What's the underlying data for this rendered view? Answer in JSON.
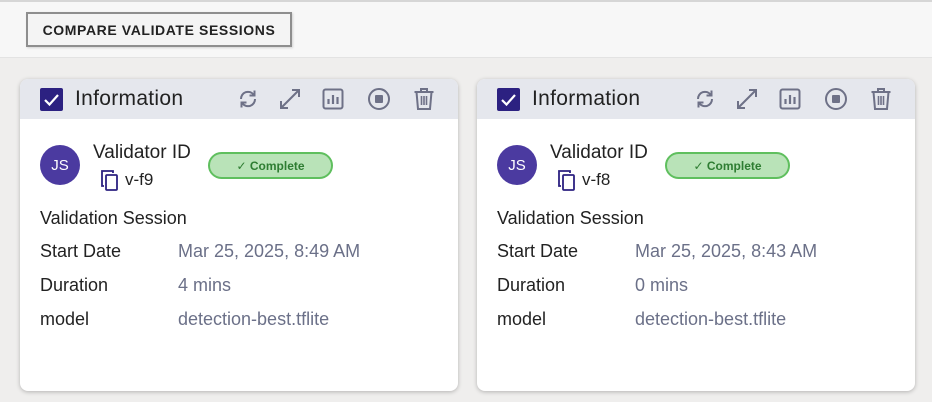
{
  "toolbar": {
    "compare_label": "COMPARE VALIDATE SESSIONS"
  },
  "colors": {
    "accent": "#2c2181",
    "avatar": "#4b3aa0",
    "badge_bg": "#b9e3b8",
    "badge_border": "#5fbf5e",
    "badge_text": "#2e7d32",
    "value_text": "#6b7088",
    "header_bg": "#e5e7ed"
  },
  "cards": [
    {
      "checked": true,
      "header_title": "Information",
      "tools": [
        "refresh-icon",
        "expand-icon",
        "chart-icon",
        "stop-icon",
        "trash-icon"
      ],
      "avatar_initials": "JS",
      "validator_label": "Validator ID",
      "validator_id": "v-f9",
      "status": "✓ Complete",
      "section_title": "Validation Session",
      "fields": [
        {
          "label": "Start Date",
          "value": "Mar 25, 2025, 8:49 AM"
        },
        {
          "label": "Duration",
          "value": "4 mins"
        },
        {
          "label": "model",
          "value": "detection-best.tflite"
        }
      ]
    },
    {
      "checked": true,
      "header_title": "Information",
      "tools": [
        "refresh-icon",
        "expand-icon",
        "chart-icon",
        "stop-icon",
        "trash-icon"
      ],
      "avatar_initials": "JS",
      "validator_label": "Validator ID",
      "validator_id": "v-f8",
      "status": "✓ Complete",
      "section_title": "Validation Session",
      "fields": [
        {
          "label": "Start Date",
          "value": "Mar 25, 2025, 8:43 AM"
        },
        {
          "label": "Duration",
          "value": "0 mins"
        },
        {
          "label": "model",
          "value": "detection-best.tflite"
        }
      ]
    }
  ]
}
